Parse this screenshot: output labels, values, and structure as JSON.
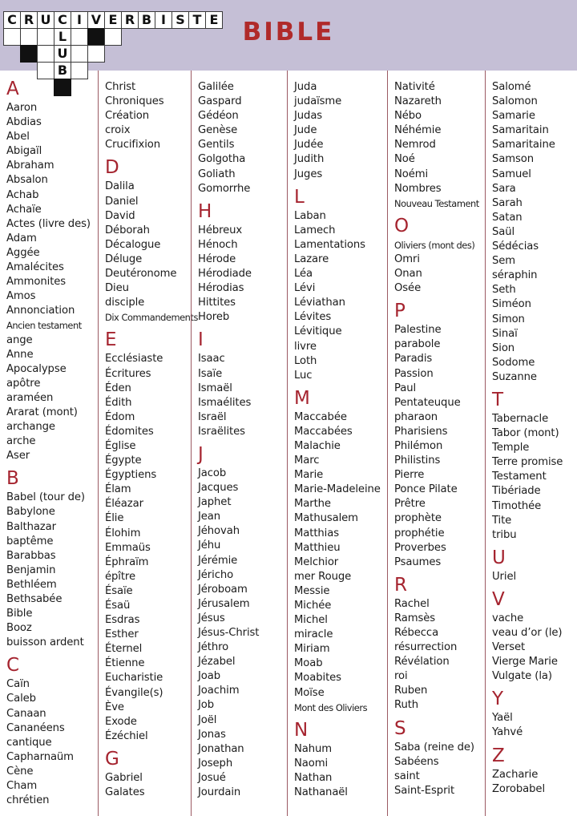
{
  "header": {
    "logo_word": "CRUCIVERBISTE",
    "logo_letters": [
      "C",
      "R",
      "U",
      "C",
      "I",
      "V",
      "E",
      "R",
      "B",
      "I",
      "S",
      "T",
      "E"
    ],
    "logo_down_word": [
      "L",
      "U",
      "B"
    ],
    "title": "BIBLE",
    "accent_color": "#a5242f",
    "header_bg": "#c5bfd6"
  },
  "columns": [
    {
      "sections": [
        {
          "letter": "A",
          "words": [
            "Aaron",
            "Abdias",
            "Abel",
            "Abigaïl",
            "Abraham",
            "Absalon",
            "Achab",
            "Achaïe",
            "Actes (livre des)",
            "Adam",
            "Aggée",
            "Amalécites",
            "Ammonites",
            "Amos",
            "Annonciation",
            "Ancien testament",
            "ange",
            "Anne",
            "Apocalypse",
            "apôtre",
            "araméen",
            "Ararat (mont)",
            "archange",
            "arche",
            "Aser"
          ],
          "condensed": [
            "Ancien testament"
          ]
        },
        {
          "letter": "B",
          "words": [
            "Babel (tour de)",
            "Babylone",
            "Balthazar",
            "baptême",
            "Barabbas",
            "Benjamin",
            "Bethléem",
            "Bethsabée",
            "Bible",
            "Booz",
            "buisson ardent"
          ],
          "condensed": []
        },
        {
          "letter": "C",
          "words": [
            "Caïn",
            "Caleb",
            "Canaan",
            "Cananéens",
            "cantique",
            "Capharnaüm",
            "Cène",
            "Cham",
            "chrétien"
          ],
          "condensed": []
        }
      ]
    },
    {
      "sections": [
        {
          "letter": "",
          "words": [
            "Christ",
            "Chroniques",
            "Création",
            "croix",
            "Crucifixion"
          ],
          "condensed": []
        },
        {
          "letter": "D",
          "words": [
            "Dalila",
            "Daniel",
            "David",
            "Déborah",
            "Décalogue",
            "Déluge",
            "Deutéronome",
            "Dieu",
            "disciple",
            "Dix Commandements"
          ],
          "condensed": [
            "Dix Commandements"
          ]
        },
        {
          "letter": "E",
          "words": [
            "Ecclésiaste",
            "Écritures",
            "Éden",
            "Édith",
            "Édom",
            "Édomites",
            "Église",
            "Égypte",
            "Égyptiens",
            "Élam",
            "Éléazar",
            "Élie",
            "Élohim",
            "Emmaüs",
            "Éphraïm",
            "épître",
            "Ésaïe",
            "Ésaü",
            "Esdras",
            "Esther",
            "Éternel",
            "Étienne",
            "Eucharistie",
            "Évangile(s)",
            "Ève",
            "Exode",
            "Ézéchiel"
          ],
          "condensed": []
        },
        {
          "letter": "G",
          "words": [
            "Gabriel",
            "Galates"
          ],
          "condensed": []
        }
      ]
    },
    {
      "sections": [
        {
          "letter": "",
          "words": [
            "Galilée",
            "Gaspard",
            "Gédéon",
            "Genèse",
            "Gentils",
            "Golgotha",
            "Goliath",
            "Gomorrhe"
          ],
          "condensed": []
        },
        {
          "letter": "H",
          "words": [
            "Hébreux",
            "Hénoch",
            "Hérode",
            "Hérodiade",
            "Hérodias",
            "Hittites",
            "Horeb"
          ],
          "condensed": []
        },
        {
          "letter": "I",
          "words": [
            "Isaac",
            "Isaïe",
            "Ismaël",
            "Ismaélites",
            "Israël",
            "Israëlites"
          ],
          "condensed": []
        },
        {
          "letter": "J",
          "words": [
            "Jacob",
            "Jacques",
            "Japhet",
            "Jean",
            "Jéhovah",
            "Jéhu",
            "Jérémie",
            "Jéricho",
            "Jéroboam",
            "Jérusalem",
            "Jésus",
            "Jésus-Christ",
            "Jéthro",
            "Jézabel",
            "Joab",
            "Joachim",
            "Job",
            "Joël",
            "Jonas",
            "Jonathan",
            "Joseph",
            "Josué",
            "Jourdain"
          ],
          "condensed": []
        }
      ]
    },
    {
      "sections": [
        {
          "letter": "",
          "words": [
            "Juda",
            "judaïsme",
            "Judas",
            "Jude",
            "Judée",
            "Judith",
            "Juges"
          ],
          "condensed": []
        },
        {
          "letter": "L",
          "words": [
            "Laban",
            "Lamech",
            "Lamentations",
            "Lazare",
            "Léa",
            "Lévi",
            "Léviathan",
            "Lévites",
            "Lévitique",
            "livre",
            "Loth",
            "Luc"
          ],
          "condensed": []
        },
        {
          "letter": "M",
          "words": [
            "Maccabée",
            "Maccabées",
            "Malachie",
            "Marc",
            "Marie",
            "Marie-Madeleine",
            "Marthe",
            "Mathusalem",
            "Matthias",
            "Matthieu",
            "Melchior",
            "mer Rouge",
            "Messie",
            "Michée",
            "Michel",
            "miracle",
            "Miriam",
            "Moab",
            "Moabites",
            "Moïse",
            "Mont des Oliviers"
          ],
          "condensed": [
            "Mont des Oliviers"
          ]
        },
        {
          "letter": "N",
          "words": [
            "Nahum",
            "Naomi",
            "Nathan",
            "Nathanaël"
          ],
          "condensed": []
        }
      ]
    },
    {
      "sections": [
        {
          "letter": "",
          "words": [
            "Nativité",
            "Nazareth",
            "Nébo",
            "Néhémie",
            "Nemrod",
            "Noé",
            "Noémi",
            "Nombres",
            "Nouveau Testament"
          ],
          "condensed": [
            "Nouveau Testament"
          ]
        },
        {
          "letter": "O",
          "words": [
            "Oliviers (mont des)",
            "Omri",
            "Onan",
            "Osée"
          ],
          "condensed": [
            "Oliviers (mont des)"
          ]
        },
        {
          "letter": "P",
          "words": [
            "Palestine",
            "parabole",
            "Paradis",
            "Passion",
            "Paul",
            "Pentateuque",
            "pharaon",
            "Pharisiens",
            "Philémon",
            "Philistins",
            "Pierre",
            "Ponce Pilate",
            "Prêtre",
            "prophète",
            "prophétie",
            "Proverbes",
            "Psaumes"
          ],
          "condensed": []
        },
        {
          "letter": "R",
          "words": [
            "Rachel",
            "Ramsès",
            "Rébecca",
            "résurrection",
            "Révélation",
            "roi",
            "Ruben",
            "Ruth"
          ],
          "condensed": []
        },
        {
          "letter": "S",
          "words": [
            "Saba (reine de)",
            "Sabéens",
            "saint",
            "Saint-Esprit"
          ],
          "condensed": []
        }
      ]
    },
    {
      "sections": [
        {
          "letter": "",
          "words": [
            "Salomé",
            "Salomon",
            "Samarie",
            "Samaritain",
            "Samaritaine",
            "Samson",
            "Samuel",
            "Sara",
            "Sarah",
            "Satan",
            "Saül",
            "Sédécias",
            "Sem",
            "séraphin",
            "Seth",
            "Siméon",
            "Simon",
            "Sinaï",
            "Sion",
            "Sodome",
            "Suzanne"
          ],
          "condensed": []
        },
        {
          "letter": "T",
          "words": [
            "Tabernacle",
            "Tabor (mont)",
            "Temple",
            "Terre promise",
            "Testament",
            "Tibériade",
            "Timothée",
            "Tite",
            "tribu"
          ],
          "condensed": []
        },
        {
          "letter": "U",
          "words": [
            "Uriel"
          ],
          "condensed": []
        },
        {
          "letter": "V",
          "words": [
            "vache",
            "veau d’or (le)",
            "Verset",
            "Vierge Marie",
            "Vulgate (la)"
          ],
          "condensed": []
        },
        {
          "letter": "Y",
          "words": [
            "Yaël",
            "Yahvé"
          ],
          "condensed": []
        },
        {
          "letter": "Z",
          "words": [
            "Zacharie",
            "Zorobabel"
          ],
          "condensed": []
        }
      ]
    }
  ]
}
